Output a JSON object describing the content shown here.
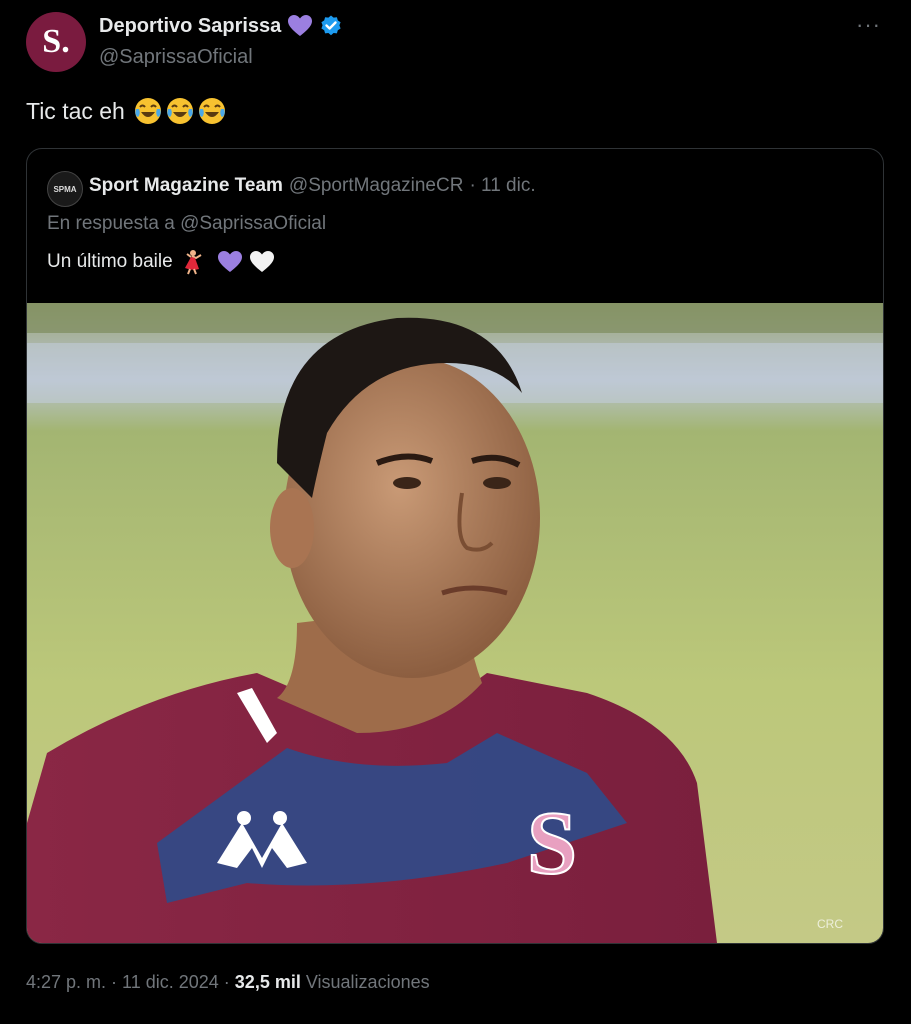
{
  "author": {
    "name": "Deportivo Saprissa",
    "handle": "@SaprissaOficial",
    "avatar_letter": "S.",
    "brand_color": "#7a1b3f"
  },
  "more_icon": "more-dots-icon",
  "tweet": {
    "text": "Tic tac eh"
  },
  "quote": {
    "avatar_text": "SPMA",
    "name": "Sport Magazine Team",
    "handle": "@SportMagazineCR",
    "date": "· 11 dic.",
    "reply_to": "En respuesta a @SaprissaOficial",
    "text": "Un último baile",
    "media_watermark": "CRC"
  },
  "footer": {
    "time": "4:27 p. m. · 11 dic. 2024 ·",
    "views_count": "32,5 mil",
    "views_label": "Visualizaciones"
  }
}
